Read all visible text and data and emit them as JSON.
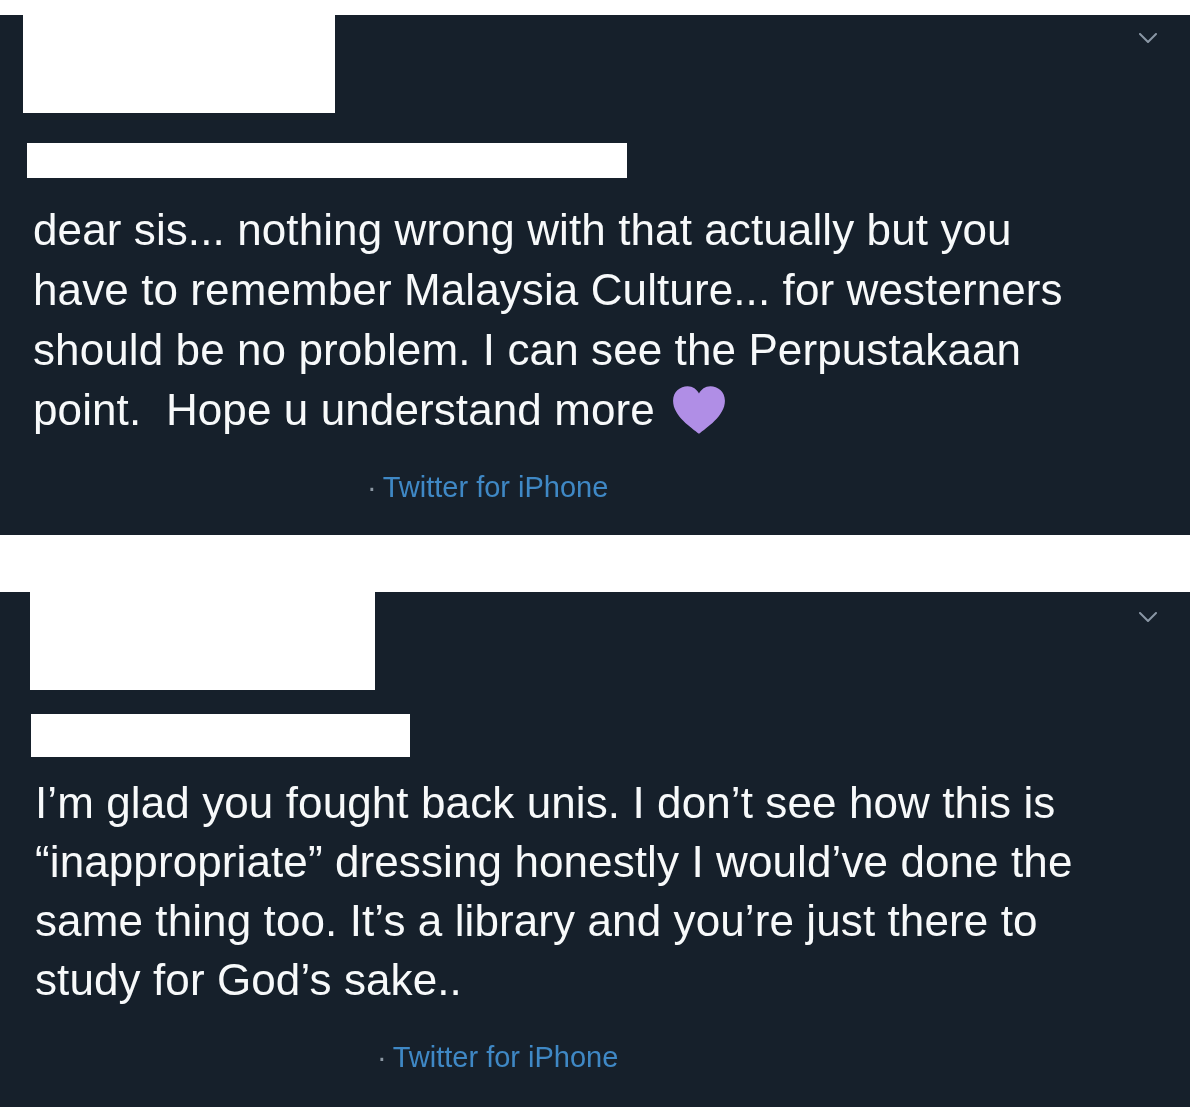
{
  "tweets": [
    {
      "has_emoji": true,
      "text_lines": [
        "dear sis... nothing wrong with that actually but you",
        "have to remember Malaysia Culture... for westerners",
        "should be no problem. I can see the Perpustakaan",
        "point.  Hope u understand more"
      ],
      "source_separator": "·",
      "source": "Twitter for iPhone"
    },
    {
      "has_emoji": false,
      "text_lines": [
        "I’m glad you fought back unis. I don’t see how this is",
        "“inappropriate” dressing honestly I would’ve done the",
        "same thing too. It’s a library and you’re just there to",
        "study for God’s sake.."
      ],
      "source_separator": "·",
      "source": "Twitter for iPhone"
    }
  ]
}
